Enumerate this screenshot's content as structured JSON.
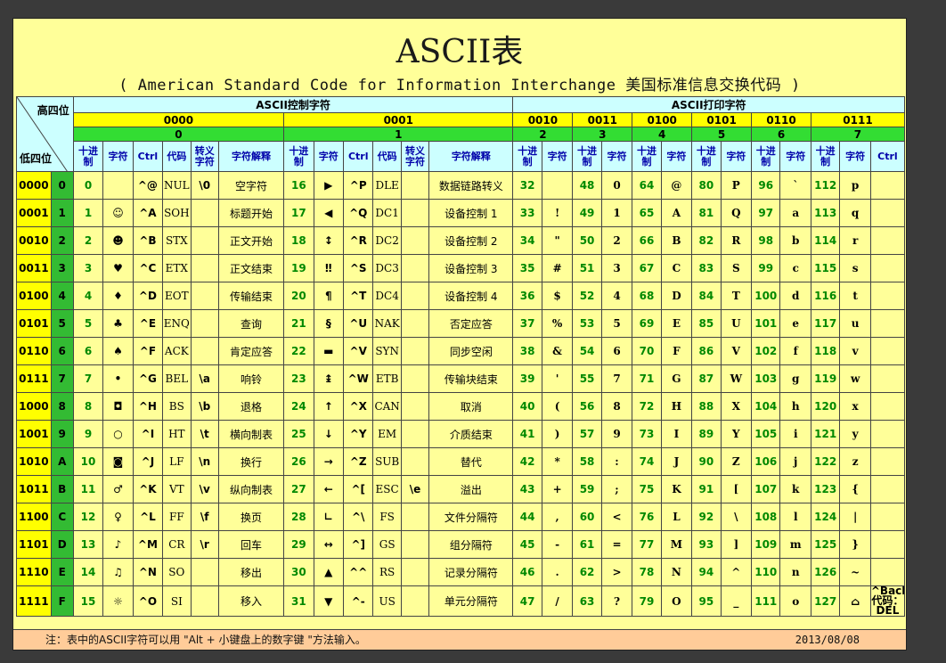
{
  "title": "ASCII表",
  "subtitle": "( American Standard Code for Information Interchange 美国标准信息交换代码 )",
  "corner": {
    "high": "高四位",
    "low": "低四位"
  },
  "sections": {
    "control": "ASCII控制字符",
    "printable": "ASCII打印字符"
  },
  "groups": [
    {
      "bin": "0000",
      "hex": "0"
    },
    {
      "bin": "0001",
      "hex": "1"
    },
    {
      "bin": "0010",
      "hex": "2"
    },
    {
      "bin": "0011",
      "hex": "3"
    },
    {
      "bin": "0100",
      "hex": "4"
    },
    {
      "bin": "0101",
      "hex": "5"
    },
    {
      "bin": "0110",
      "hex": "6"
    },
    {
      "bin": "0111",
      "hex": "7"
    }
  ],
  "subheaders": {
    "dec": "十进制",
    "char": "字符",
    "ctrl": "Ctrl",
    "code": "代码",
    "escape": "转义字符",
    "desc": "字符解释"
  },
  "rows": [
    {
      "bin": "0000",
      "hex": "0",
      "d0": "0",
      "c0": "",
      "k0": "^@",
      "n0": "NUL",
      "e0": "\\0",
      "x0": "空字符",
      "d1": "16",
      "c1": "▶",
      "k1": "^P",
      "n1": "DLE",
      "e1": "",
      "x1": "数据链路转义",
      "d2": "32",
      "c2": "",
      "d3": "48",
      "c3": "0",
      "d4": "64",
      "c4": "@",
      "d5": "80",
      "c5": "P",
      "d6": "96",
      "c6": "`",
      "d7": "112",
      "c7": "p",
      "k7": ""
    },
    {
      "bin": "0001",
      "hex": "1",
      "d0": "1",
      "c0": "☺",
      "k0": "^A",
      "n0": "SOH",
      "e0": "",
      "x0": "标题开始",
      "d1": "17",
      "c1": "◀",
      "k1": "^Q",
      "n1": "DC1",
      "e1": "",
      "x1": "设备控制 1",
      "d2": "33",
      "c2": "!",
      "d3": "49",
      "c3": "1",
      "d4": "65",
      "c4": "A",
      "d5": "81",
      "c5": "Q",
      "d6": "97",
      "c6": "a",
      "d7": "113",
      "c7": "q",
      "k7": ""
    },
    {
      "bin": "0010",
      "hex": "2",
      "d0": "2",
      "c0": "☻",
      "k0": "^B",
      "n0": "STX",
      "e0": "",
      "x0": "正文开始",
      "d1": "18",
      "c1": "↕",
      "k1": "^R",
      "n1": "DC2",
      "e1": "",
      "x1": "设备控制 2",
      "d2": "34",
      "c2": "\"",
      "d3": "50",
      "c3": "2",
      "d4": "66",
      "c4": "B",
      "d5": "82",
      "c5": "R",
      "d6": "98",
      "c6": "b",
      "d7": "114",
      "c7": "r",
      "k7": ""
    },
    {
      "bin": "0011",
      "hex": "3",
      "d0": "3",
      "c0": "♥",
      "k0": "^C",
      "n0": "ETX",
      "e0": "",
      "x0": "正文结束",
      "d1": "19",
      "c1": "‼",
      "k1": "^S",
      "n1": "DC3",
      "e1": "",
      "x1": "设备控制 3",
      "d2": "35",
      "c2": "#",
      "d3": "51",
      "c3": "3",
      "d4": "67",
      "c4": "C",
      "d5": "83",
      "c5": "S",
      "d6": "99",
      "c6": "c",
      "d7": "115",
      "c7": "s",
      "k7": ""
    },
    {
      "bin": "0100",
      "hex": "4",
      "d0": "4",
      "c0": "♦",
      "k0": "^D",
      "n0": "EOT",
      "e0": "",
      "x0": "传输结束",
      "d1": "20",
      "c1": "¶",
      "k1": "^T",
      "n1": "DC4",
      "e1": "",
      "x1": "设备控制 4",
      "d2": "36",
      "c2": "$",
      "d3": "52",
      "c3": "4",
      "d4": "68",
      "c4": "D",
      "d5": "84",
      "c5": "T",
      "d6": "100",
      "c6": "d",
      "d7": "116",
      "c7": "t",
      "k7": ""
    },
    {
      "bin": "0101",
      "hex": "5",
      "d0": "5",
      "c0": "♣",
      "k0": "^E",
      "n0": "ENQ",
      "e0": "",
      "x0": "查询",
      "d1": "21",
      "c1": "§",
      "k1": "^U",
      "n1": "NAK",
      "e1": "",
      "x1": "否定应答",
      "d2": "37",
      "c2": "%",
      "d3": "53",
      "c3": "5",
      "d4": "69",
      "c4": "E",
      "d5": "85",
      "c5": "U",
      "d6": "101",
      "c6": "e",
      "d7": "117",
      "c7": "u",
      "k7": ""
    },
    {
      "bin": "0110",
      "hex": "6",
      "d0": "6",
      "c0": "♠",
      "k0": "^F",
      "n0": "ACK",
      "e0": "",
      "x0": "肯定应答",
      "d1": "22",
      "c1": "▬",
      "k1": "^V",
      "n1": "SYN",
      "e1": "",
      "x1": "同步空闲",
      "d2": "38",
      "c2": "&",
      "d3": "54",
      "c3": "6",
      "d4": "70",
      "c4": "F",
      "d5": "86",
      "c5": "V",
      "d6": "102",
      "c6": "f",
      "d7": "118",
      "c7": "v",
      "k7": ""
    },
    {
      "bin": "0111",
      "hex": "7",
      "d0": "7",
      "c0": "•",
      "k0": "^G",
      "n0": "BEL",
      "e0": "\\a",
      "x0": "响铃",
      "d1": "23",
      "c1": "↨",
      "k1": "^W",
      "n1": "ETB",
      "e1": "",
      "x1": "传输块结束",
      "d2": "39",
      "c2": "'",
      "d3": "55",
      "c3": "7",
      "d4": "71",
      "c4": "G",
      "d5": "87",
      "c5": "W",
      "d6": "103",
      "c6": "g",
      "d7": "119",
      "c7": "w",
      "k7": ""
    },
    {
      "bin": "1000",
      "hex": "8",
      "d0": "8",
      "c0": "◘",
      "k0": "^H",
      "n0": "BS",
      "e0": "\\b",
      "x0": "退格",
      "d1": "24",
      "c1": "↑",
      "k1": "^X",
      "n1": "CAN",
      "e1": "",
      "x1": "取消",
      "d2": "40",
      "c2": "(",
      "d3": "56",
      "c3": "8",
      "d4": "72",
      "c4": "H",
      "d5": "88",
      "c5": "X",
      "d6": "104",
      "c6": "h",
      "d7": "120",
      "c7": "x",
      "k7": ""
    },
    {
      "bin": "1001",
      "hex": "9",
      "d0": "9",
      "c0": "○",
      "k0": "^I",
      "n0": "HT",
      "e0": "\\t",
      "x0": "横向制表",
      "d1": "25",
      "c1": "↓",
      "k1": "^Y",
      "n1": "EM",
      "e1": "",
      "x1": "介质结束",
      "d2": "41",
      "c2": ")",
      "d3": "57",
      "c3": "9",
      "d4": "73",
      "c4": "I",
      "d5": "89",
      "c5": "Y",
      "d6": "105",
      "c6": "i",
      "d7": "121",
      "c7": "y",
      "k7": ""
    },
    {
      "bin": "1010",
      "hex": "A",
      "d0": "10",
      "c0": "◙",
      "k0": "^J",
      "n0": "LF",
      "e0": "\\n",
      "x0": "换行",
      "d1": "26",
      "c1": "→",
      "k1": "^Z",
      "n1": "SUB",
      "e1": "",
      "x1": "替代",
      "d2": "42",
      "c2": "*",
      "d3": "58",
      "c3": ":",
      "d4": "74",
      "c4": "J",
      "d5": "90",
      "c5": "Z",
      "d6": "106",
      "c6": "j",
      "d7": "122",
      "c7": "z",
      "k7": ""
    },
    {
      "bin": "1011",
      "hex": "B",
      "d0": "11",
      "c0": "♂",
      "k0": "^K",
      "n0": "VT",
      "e0": "\\v",
      "x0": "纵向制表",
      "d1": "27",
      "c1": "←",
      "k1": "^[",
      "n1": "ESC",
      "e1": "\\e",
      "x1": "溢出",
      "d2": "43",
      "c2": "+",
      "d3": "59",
      "c3": ";",
      "d4": "75",
      "c4": "K",
      "d5": "91",
      "c5": "[",
      "d6": "107",
      "c6": "k",
      "d7": "123",
      "c7": "{",
      "k7": ""
    },
    {
      "bin": "1100",
      "hex": "C",
      "d0": "12",
      "c0": "♀",
      "k0": "^L",
      "n0": "FF",
      "e0": "\\f",
      "x0": "换页",
      "d1": "28",
      "c1": "∟",
      "k1": "^\\",
      "n1": "FS",
      "e1": "",
      "x1": "文件分隔符",
      "d2": "44",
      "c2": ",",
      "d3": "60",
      "c3": "<",
      "d4": "76",
      "c4": "L",
      "d5": "92",
      "c5": "\\",
      "d6": "108",
      "c6": "l",
      "d7": "124",
      "c7": "|",
      "k7": ""
    },
    {
      "bin": "1101",
      "hex": "D",
      "d0": "13",
      "c0": "♪",
      "k0": "^M",
      "n0": "CR",
      "e0": "\\r",
      "x0": "回车",
      "d1": "29",
      "c1": "↔",
      "k1": "^]",
      "n1": "GS",
      "e1": "",
      "x1": "组分隔符",
      "d2": "45",
      "c2": "-",
      "d3": "61",
      "c3": "=",
      "d4": "77",
      "c4": "M",
      "d5": "93",
      "c5": "]",
      "d6": "109",
      "c6": "m",
      "d7": "125",
      "c7": "}",
      "k7": ""
    },
    {
      "bin": "1110",
      "hex": "E",
      "d0": "14",
      "c0": "♫",
      "k0": "^N",
      "n0": "SO",
      "e0": "",
      "x0": "移出",
      "d1": "30",
      "c1": "▲",
      "k1": "^^",
      "n1": "RS",
      "e1": "",
      "x1": "记录分隔符",
      "d2": "46",
      "c2": ".",
      "d3": "62",
      "c3": ">",
      "d4": "78",
      "c4": "N",
      "d5": "94",
      "c5": "^",
      "d6": "110",
      "c6": "n",
      "d7": "126",
      "c7": "~",
      "k7": ""
    },
    {
      "bin": "1111",
      "hex": "F",
      "d0": "15",
      "c0": "☼",
      "k0": "^O",
      "n0": "SI",
      "e0": "",
      "x0": "移入",
      "d1": "31",
      "c1": "▼",
      "k1": "^-",
      "n1": "US",
      "e1": "",
      "x1": "单元分隔符",
      "d2": "47",
      "c2": "/",
      "d3": "63",
      "c3": "?",
      "d4": "79",
      "c4": "O",
      "d5": "95",
      "c5": "_",
      "d6": "111",
      "c6": "o",
      "d7": "127",
      "c7": "⌂",
      "k7": "^Backspace 代码：DEL"
    }
  ],
  "note": "注：表中的ASCII字符可以用 \"Alt + 小键盘上的数字键 \"方法输入。",
  "date": "2013/08/08"
}
